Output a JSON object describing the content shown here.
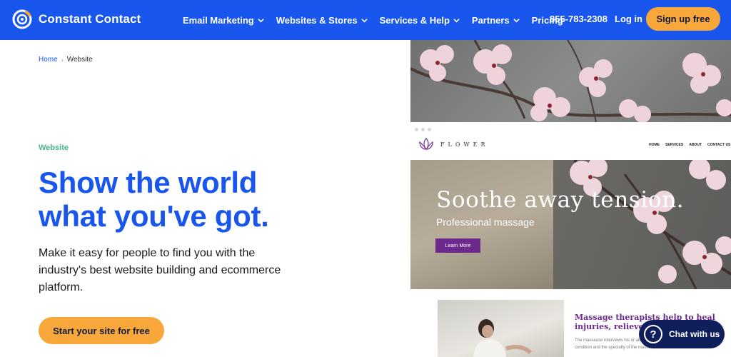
{
  "header": {
    "logo_text": "Constant Contact",
    "nav": [
      "Email Marketing",
      "Websites & Stores",
      "Services & Help",
      "Partners",
      "Pricing"
    ],
    "phone": "855-783-2308",
    "login_label": "Log in",
    "signup_label": "Sign up free"
  },
  "breadcrumb": {
    "home": "Home",
    "separator": "›",
    "current": "Website"
  },
  "hero": {
    "eyebrow": "Website",
    "title_line1": "Show the world",
    "title_line2": "what you've got.",
    "description": "Make it easy for people to find you with the industry's best website building and ecommerce platform.",
    "cta_label": "Start your site for free"
  },
  "preview": {
    "site_logo": "FLOWER",
    "site_nav": [
      "HOME",
      "SERVICES",
      "ABOUT",
      "CONTACT US"
    ],
    "headline": "Soothe away tension.",
    "subheadline": "Professional massage",
    "button_label": "Learn More",
    "lower_heading": "Massage therapists help to heal injuries, relieve stress and al",
    "lower_body": "The masseuse interviews his or ailments and implements a treatm condition and the specialty of the masseuse."
  },
  "chat": {
    "label": "Chat with us",
    "icon": "?"
  },
  "colors": {
    "brand_blue": "#1856ed",
    "cta_orange": "#f8a73b",
    "eyebrow_green": "#47b389",
    "accent_purple": "#6b2a8c",
    "chat_navy": "#0f1f5c"
  }
}
